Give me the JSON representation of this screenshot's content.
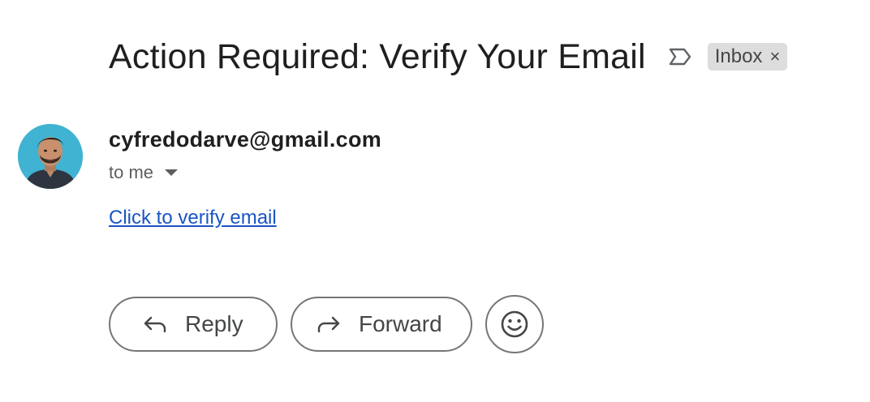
{
  "email": {
    "subject": "Action Required: Verify Your Email",
    "label": "Inbox",
    "label_remove_glyph": "×",
    "importance_icon": "importance-marker-icon",
    "sender": {
      "address": "cyfredodarve@gmail.com",
      "avatar": "profile-photo-avatar"
    },
    "recipients_text": "to me",
    "body": {
      "link_text": "Click to verify email"
    }
  },
  "actions": {
    "reply_label": "Reply",
    "forward_label": "Forward",
    "reply_icon": "reply-arrow-icon",
    "forward_icon": "forward-arrow-icon",
    "emoji_icon": "smiley-face-icon"
  },
  "colors": {
    "link": "#1a55c2",
    "chip_bg": "#dddddd",
    "border": "#747775",
    "avatar_bg": "#3fb3d1"
  }
}
